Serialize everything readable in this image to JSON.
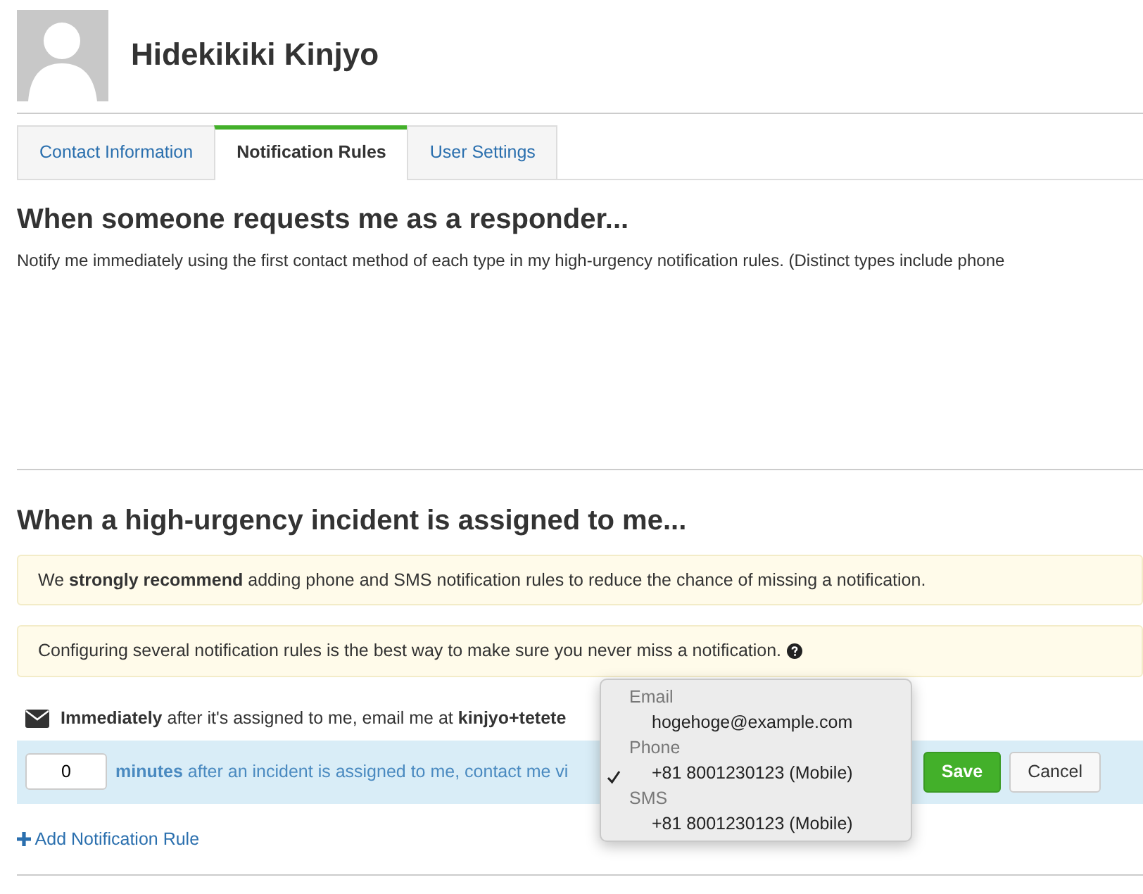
{
  "user": {
    "name": "Hidekikiki Kinjyo"
  },
  "tabs": [
    {
      "label": "Contact Information",
      "selected": false
    },
    {
      "label": "Notification Rules",
      "selected": true
    },
    {
      "label": "User Settings",
      "selected": false
    }
  ],
  "responder": {
    "heading": "When someone requests me as a responder...",
    "text": "Notify me immediately using the first contact method of each type in my high-urgency notification rules. (Distinct types include phone"
  },
  "high_urgency": {
    "heading": "When a high-urgency incident is assigned to me...",
    "alerts": [
      "We **strongly recommend** adding phone and SMS notification rules to reduce the chance of missing a notification.",
      "Configuring several notification rules is the best way to make sure you never miss a notification."
    ],
    "rule": "**Immediately** after it's assigned to me, email me at **kinjyo+tetete**",
    "edit_row": {
      "minutes": "0",
      "text": "**minutes** after an incident is assigned to me, contact me vi",
      "save": "Save",
      "cancel": "Cancel"
    },
    "menu": [
      {
        "group": "Email",
        "options": [
          {
            "label": "hogehoge@example.com",
            "selected": false
          }
        ]
      },
      {
        "group": "Phone",
        "options": [
          {
            "label": "+81 8001230123 (Mobile)",
            "selected": true
          }
        ]
      },
      {
        "group": "SMS",
        "options": [
          {
            "label": "+81 8001230123 (Mobile)",
            "selected": false
          }
        ]
      }
    ],
    "add_link": "Add Notification Rule"
  }
}
